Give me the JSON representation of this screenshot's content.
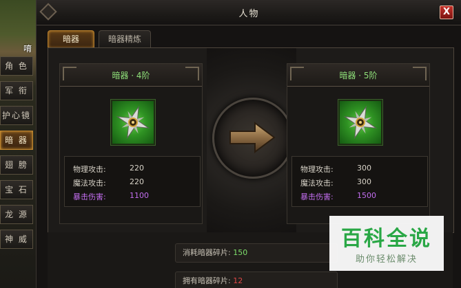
{
  "world": {
    "player_name_partial": "唷"
  },
  "window": {
    "title": "人物",
    "close_label": "X"
  },
  "tabs": [
    {
      "label": "暗器",
      "active": true
    },
    {
      "label": "暗器精炼",
      "active": false
    }
  ],
  "sidebar": {
    "items": [
      {
        "label": "角 色",
        "active": false
      },
      {
        "label": "军 衔",
        "active": false
      },
      {
        "label": "护心镜",
        "active": false
      },
      {
        "label": "暗 器",
        "active": true
      },
      {
        "label": "翅 膀",
        "active": false
      },
      {
        "label": "宝 石",
        "active": false
      },
      {
        "label": "龙 源",
        "active": false
      },
      {
        "label": "神 威",
        "active": false
      }
    ]
  },
  "current": {
    "title": "暗器 · 4阶",
    "icon": "shuriken-icon",
    "stats": [
      {
        "label": "物理攻击:",
        "value": "220"
      },
      {
        "label": "魔法攻击:",
        "value": "220"
      },
      {
        "label": "暴击伤害:",
        "value": "1100"
      }
    ]
  },
  "next": {
    "title": "暗器 · 5阶",
    "icon": "shuriken-icon",
    "stats": [
      {
        "label": "物理攻击:",
        "value": "300"
      },
      {
        "label": "魔法攻击:",
        "value": "300"
      },
      {
        "label": "暴击伤害:",
        "value": "1500"
      }
    ]
  },
  "upgrade_arrow_icon": "arrow-right-icon",
  "cost": {
    "consume_label": "消耗暗器碎片:",
    "consume_value": "150",
    "own_label": "拥有暗器碎片:",
    "own_value": "12"
  },
  "watermark": {
    "logo": "百科全说",
    "slogan": "助你轻松解决"
  },
  "colors": {
    "title_green": "#8fe07a",
    "crit_purple": "#c36ef0",
    "value_green": "#7fe06c",
    "value_red": "#e04848",
    "active_gold": "#c0862f",
    "close_red": "#c4312a"
  }
}
